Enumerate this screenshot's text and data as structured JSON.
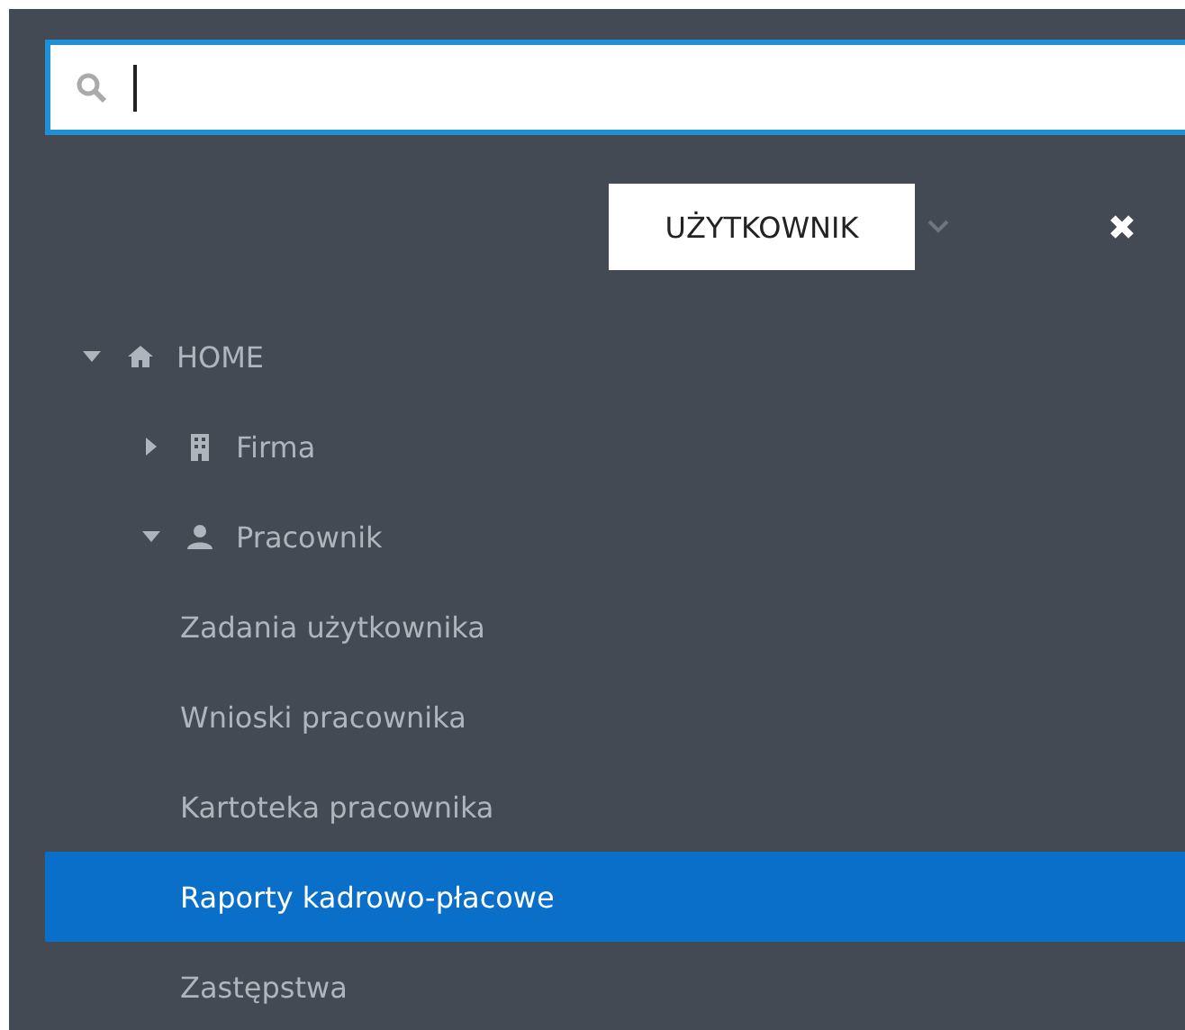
{
  "search": {
    "focused": true
  },
  "role_select": {
    "value": "UŻYTKOWNIK"
  },
  "tree": [
    {
      "label": "HOME",
      "kind": "home",
      "expanded": true,
      "children": [
        {
          "label": "Firma",
          "kind": "building",
          "expanded": false
        },
        {
          "label": "Pracownik",
          "kind": "user",
          "expanded": true,
          "children": [
            {
              "label": "Zadania użytkownika",
              "selected": false
            },
            {
              "label": "Wnioski pracownika",
              "selected": false
            },
            {
              "label": "Kartoteka pracownika",
              "selected": false
            },
            {
              "label": "Raporty kadrowo-płacowe",
              "selected": true
            },
            {
              "label": "Zastępstwa",
              "selected": false
            }
          ]
        }
      ]
    }
  ]
}
